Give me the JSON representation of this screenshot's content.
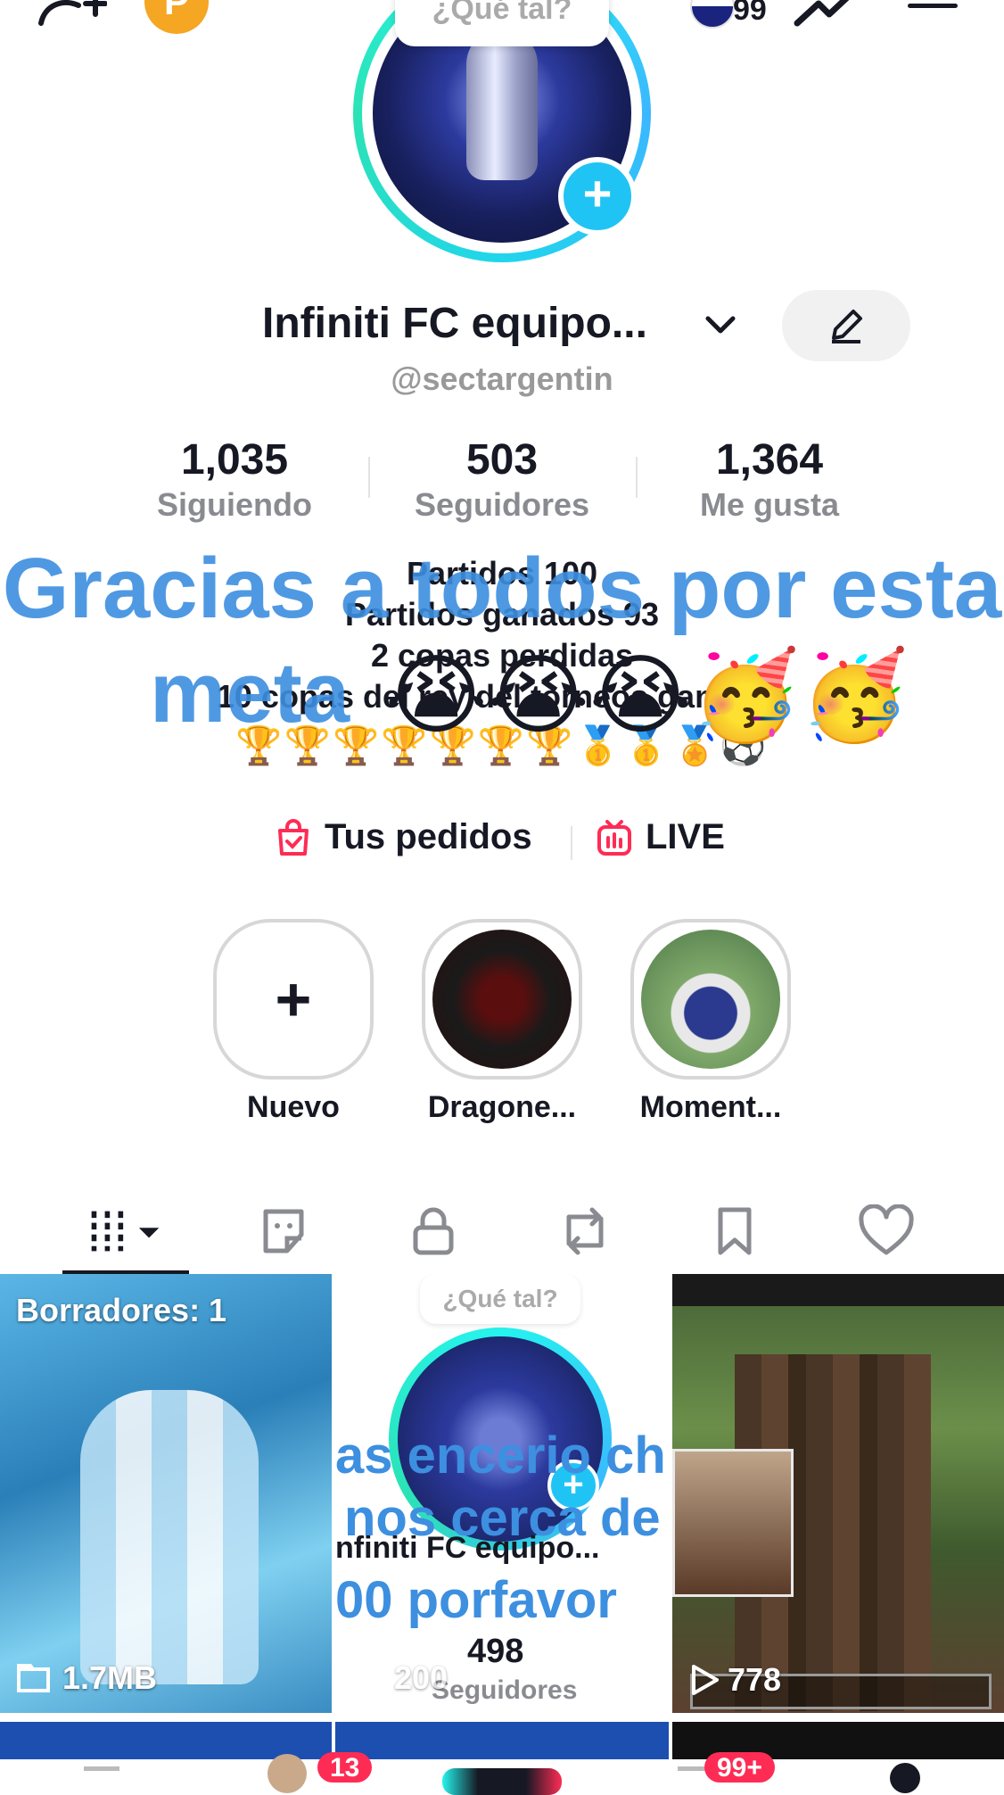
{
  "top_bar": {
    "coin_letter": "P",
    "badge_count": "99"
  },
  "avatar": {
    "bubble_text": "¿Qué tal?",
    "add_symbol": "+"
  },
  "profile": {
    "name": "Infiniti FC equipo...",
    "handle": "@sectargentin"
  },
  "stats": [
    {
      "value": "1,035",
      "label": "Siguiendo"
    },
    {
      "value": "503",
      "label": "Seguidores"
    },
    {
      "value": "1,364",
      "label": "Me gusta"
    }
  ],
  "bio": {
    "lines": [
      "Partidos 100",
      "Partidos ganados 93",
      "2 copas perdidas",
      "10 copas del rey del torneos ganadas"
    ],
    "emoji_line": "🏆🏆🏆🏆🏆🏆🏆🥇🥇🏅⚽",
    "overlay_line1": "Gracias a todos por esta",
    "overlay_line2": "meta",
    "overlay_emojis": "😭😭😭🥳🥳"
  },
  "links": {
    "orders": "Tus pedidos",
    "live": "LIVE"
  },
  "highlights": [
    {
      "label": "Nuevo",
      "symbol": "+"
    },
    {
      "label": "Dragone..."
    },
    {
      "label": "Moment..."
    }
  ],
  "grid": {
    "items": [
      {
        "label": "Borradores: 1",
        "size": "1.7MB"
      },
      {
        "bubble": "¿Qué tal?",
        "overlay1": "as encerio chic",
        "overlay2": "nos cerca de",
        "name": "nfiniti FC equipo...",
        "overlay3": "00 porfavor",
        "num": "498",
        "lbl": "Seguidores",
        "views": "200"
      },
      {
        "views": "778"
      }
    ]
  },
  "navbar": {
    "inbox_badge": "13",
    "profile_badge": "99+"
  },
  "colors": {
    "accent": "#fe2c55",
    "overlay_blue": "#3d8fe0",
    "ring_cyan": "#25f4ee"
  }
}
